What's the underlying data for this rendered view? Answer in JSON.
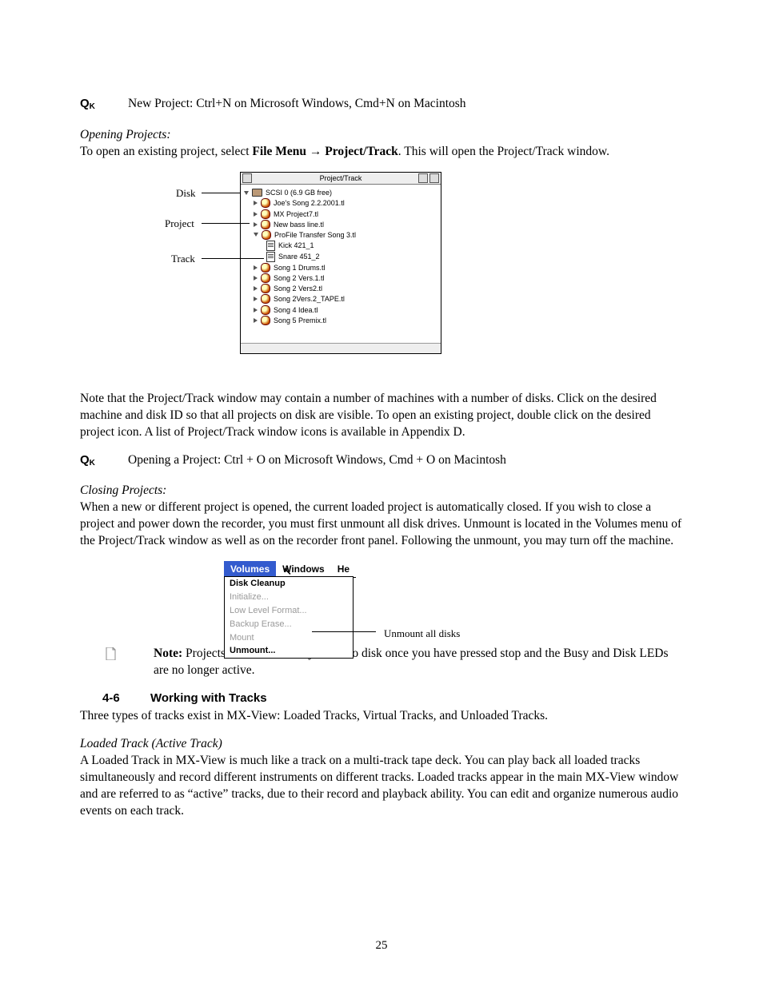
{
  "qk": "Q",
  "qk_sub": "K",
  "qk1_text": "New Project: Ctrl+N on Microsoft Windows, Cmd+N on Macintosh",
  "opening_heading": "Opening Projects:",
  "opening_sentence_pre": "To open an existing project, select ",
  "opening_bold1": "File Menu ",
  "opening_arrow": "→",
  "opening_bold2": " Project/Track",
  "opening_sentence_post": ".  This will open the Project/Track window.",
  "fig_pt": {
    "title": "Project/Track",
    "disk_row": "SCSI 0     (6.9 GB free)",
    "items": [
      "Joe's Song 2.2.2001.tl",
      "MX Project7.tl",
      "New bass line.tl"
    ],
    "open_proj": "ProFile Transfer Song 3.tl",
    "tracks": [
      "Kick 421_1",
      "Snare 451_2"
    ],
    "items2": [
      "Song 1 Drums.tl",
      "Song 2 Vers.1.tl",
      "Song 2 Vers2.tl",
      "Song 2Vers.2_TAPE.tl",
      "Song 4 Idea.tl",
      "Song 5 Premix.tl"
    ],
    "lbl_disk": "Disk",
    "lbl_project": "Project",
    "lbl_track": "Track"
  },
  "pt_note": "Note that the Project/Track window may contain a number of machines with a number of disks. Click on the desired machine and disk ID so that all projects on disk are visible. To open an existing project, double click on the desired project icon.  A list of Project/Track window icons is available in Appendix D.",
  "qk2_text": "Opening a Project: Ctrl + O on Microsoft Windows, Cmd + O on Macintosh",
  "closing_heading": "Closing Projects:",
  "closing_text": "When a new or different project is opened, the current loaded project is automatically closed. If you wish to close a project and power down the recorder, you must first unmount all disk drives. Unmount is located in the Volumes menu of the Project/Track window as well as on the recorder front panel. Following the unmount, you may turn off the machine.",
  "fig_vol": {
    "menu_volumes": "Volumes",
    "menu_windows": "Windows",
    "menu_he": "He",
    "item_cleanup": "Disk Cleanup",
    "item_init": "Initialize...",
    "item_llf": "Low Level Format...",
    "item_backup": "Backup Erase...",
    "item_mount": "Mount",
    "item_unmount": "Unmount...",
    "callout": "Unmount all disks"
  },
  "note_label": "Note:",
  "note_text": " Projects are automatically saved to disk once you have pressed stop and the Busy and Disk LEDs are no longer active.",
  "sec_num": "4-6",
  "sec_title": "Working with Tracks",
  "sec_intro": "Three types of tracks exist in MX-View: Loaded Tracks, Virtual Tracks, and Unloaded Tracks.",
  "loaded_heading": "Loaded Track (Active Track)",
  "loaded_text": "A Loaded Track in MX-View is much like a track on a multi-track tape deck. You can play back all loaded tracks simultaneously and record different instruments on different tracks. Loaded tracks appear in the main MX-View window and are referred to as “active” tracks, due to their record and playback ability. You can edit and organize numerous audio events on each track.",
  "page_number": "25"
}
